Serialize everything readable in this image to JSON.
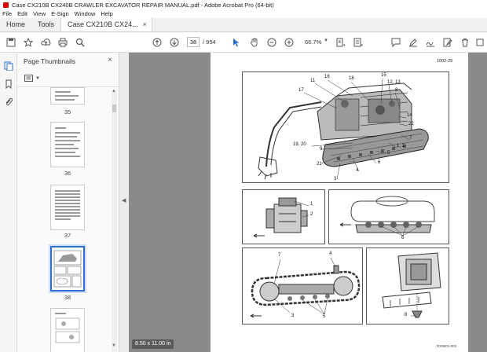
{
  "window": {
    "title": "Case CX210B CX240B CRAWLER EXCAVATOR REPAIR MANUAL.pdf - Adobe Acrobat Pro (64-bit)"
  },
  "menu": [
    "File",
    "Edit",
    "View",
    "E-Sign",
    "Window",
    "Help"
  ],
  "tabs": {
    "home": "Home",
    "tools": "Tools",
    "document": "Case CX210B CX24...",
    "close": "×"
  },
  "toolbar": {
    "page_current": "38",
    "page_total": "/ 954",
    "zoom": "66.7%"
  },
  "thumbnails_panel": {
    "title": "Page Thumbnails",
    "close": "×",
    "pages": [
      {
        "label": "35"
      },
      {
        "label": "36"
      },
      {
        "label": "37"
      },
      {
        "label": "38",
        "selected": true
      }
    ]
  },
  "document_page": {
    "page_code": "1002-29",
    "footer_code": "RS9801-002",
    "callouts_main": [
      "11",
      "16",
      "18",
      "15",
      "12, 13",
      "8",
      "17",
      "14",
      "22",
      "7",
      "1, 2",
      "19, 20",
      "9",
      "5",
      "6",
      "4",
      "21",
      "3"
    ],
    "callouts_mid_left": [
      "1",
      "2"
    ],
    "callouts_mid_right": [
      "6"
    ],
    "callouts_bottom_left": [
      "7",
      "4",
      "3",
      "5"
    ],
    "callouts_bottom_right": [
      "8"
    ]
  },
  "page_size_badge": "8.50 x 11.00 in",
  "colors": {
    "viewer_bg": "#888a8c",
    "accent": "#2f6fce",
    "app_red": "#dd0000"
  }
}
